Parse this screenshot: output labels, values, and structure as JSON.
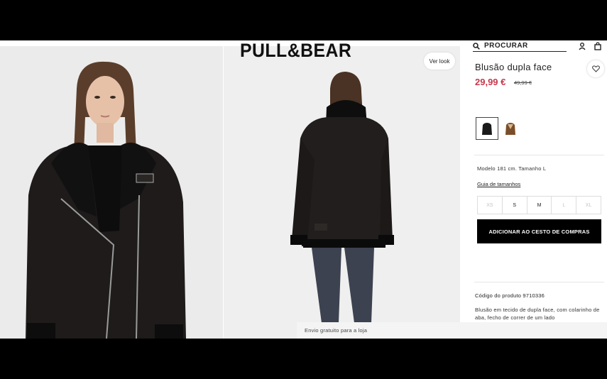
{
  "brand": {
    "logo": "PULL&BEAR"
  },
  "header": {
    "search_label": "PROCURAR",
    "account_icon": "user-icon",
    "bag_icon": "bag-icon"
  },
  "gallery": {
    "ver_look": "Ver look"
  },
  "product": {
    "title": "Blusão dupla face",
    "price": "29,99 €",
    "old_price": "49,99 €",
    "colors": [
      {
        "name": "black",
        "hex": "#1a1a1a",
        "selected": true
      },
      {
        "name": "brown",
        "hex": "#7a4e2a",
        "selected": false
      }
    ],
    "model_info": "Modelo 181 cm. Tamanho L",
    "size_guide": "Guia de tamanhos",
    "sizes": [
      {
        "label": "XS",
        "available": false
      },
      {
        "label": "S",
        "available": true
      },
      {
        "label": "M",
        "available": true
      },
      {
        "label": "L",
        "available": false
      },
      {
        "label": "XL",
        "available": false
      }
    ],
    "add_to_cart": "ADICIONAR AO CESTO DE COMPRAS",
    "code_label": "Código do produto 9710336",
    "description": "Blusão em tecido de dupla face, com colarinho de aba, fecho de correr de um lado"
  },
  "shipping": {
    "text": "Envio gratuito para a loja"
  },
  "colors": {
    "price_red": "#c8374b",
    "button_black": "#000000"
  }
}
